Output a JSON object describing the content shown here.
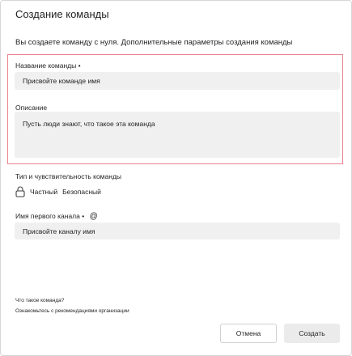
{
  "dialog": {
    "title": "Создание команды",
    "subtitle": "Вы создаете команду с нуля. Дополнительные параметры создания команды",
    "team_name": {
      "label": "Название команды",
      "required_mark": "•",
      "placeholder": "Присвойте команде имя"
    },
    "description": {
      "label": "Описание",
      "placeholder": "Пусть люди знают, что такое эта команда"
    },
    "type_section": {
      "label": "Тип и чувствительность команды",
      "privacy": "Частный",
      "sensitivity": "Безопасный",
      "lock_icon": "lock-icon"
    },
    "channel": {
      "label": "Имя первого канала",
      "required_mark": "•",
      "mention_symbol": "@",
      "placeholder": "Присвойте каналу имя"
    },
    "links": {
      "what_is_team": "Что такое команда?",
      "org_recommendations": "Ознакомьтесь с рекомендациями организации"
    },
    "buttons": {
      "cancel": "Отмена",
      "create": "Создать"
    },
    "colors": {
      "highlight_border": "#e8848e",
      "input_bg": "#f0f0f0",
      "create_bg": "#ebebeb"
    }
  }
}
